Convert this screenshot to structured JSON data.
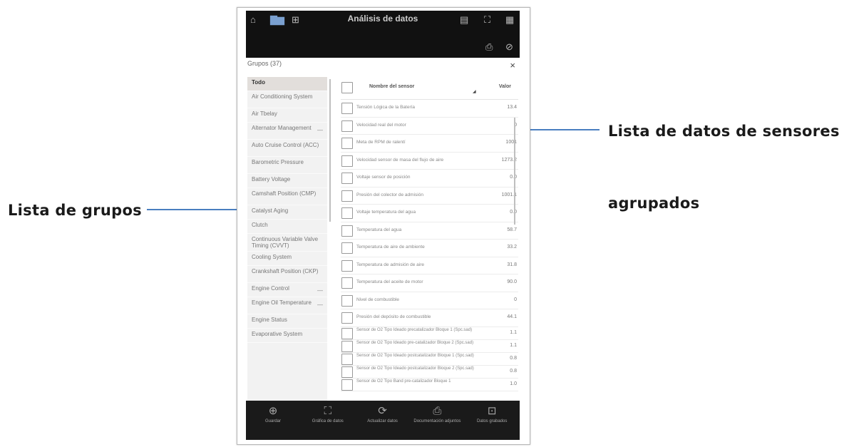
{
  "callouts": {
    "left_label": "Lista de grupos",
    "right_label_line1": "Lista de datos de sensores",
    "right_label_line2": "agrupados"
  },
  "app": {
    "title": "Análisis de datos",
    "groups_header": "Grupos (37)",
    "close_icon": "×"
  },
  "groups": [
    {
      "label": "Todo",
      "selected": true
    },
    {
      "label": "Air Conditioning System"
    },
    {
      "label": "Air Tbelay"
    },
    {
      "label": "Alternator Management",
      "dash": "—"
    },
    {
      "label": "Auto Cruise Control (ACC)"
    },
    {
      "label": "Barometric Pressure"
    },
    {
      "label": "Battery Voltage"
    },
    {
      "label": "Camshaft Position (CMP)"
    },
    {
      "label": "Catalyst Aging"
    },
    {
      "label": "Clutch"
    },
    {
      "label": "Continuous Variable Valve Timing (CVVT)"
    },
    {
      "label": "Cooling System"
    },
    {
      "label": "Crankshaft Position (CKP)"
    },
    {
      "label": "Engine Control",
      "dash": "—"
    },
    {
      "label": "Engine Oil Temperature",
      "dash": "—"
    },
    {
      "label": "Engine Status"
    },
    {
      "label": "Evaporative System"
    }
  ],
  "table": {
    "col_name": "Nombre del sensor",
    "col_value": "Valor",
    "rows": [
      {
        "name": "Tensión Lógica de la Batería",
        "value": "13.4"
      },
      {
        "name": "Velocidad real del motor",
        "value": "0"
      },
      {
        "name": "Meta de RPM de ralentí",
        "value": "1001"
      },
      {
        "name": "Velocidad sensor de masa del flujo de aire",
        "value": "1273.2"
      },
      {
        "name": "Voltaje sensor de posición",
        "value": "0.0"
      },
      {
        "name": "Presión del colector de admisión",
        "value": "1001.1"
      },
      {
        "name": "Voltaje temperatura del agua",
        "value": "0.0"
      },
      {
        "name": "Temperatura del agua",
        "value": "58.7"
      },
      {
        "name": "Temperatura de aire de ambiente",
        "value": "33.2"
      },
      {
        "name": "Temperatura de admisión de aire",
        "value": "31.8"
      },
      {
        "name": "Temperatura del aceite de motor",
        "value": "90.0"
      },
      {
        "name": "Nivel de combustible",
        "value": "0"
      },
      {
        "name": "Presión del depósito de combustible",
        "value": "44.1"
      }
    ],
    "multi_rows": [
      {
        "name": "Sensor de O2 Tipo Ideado precatalizador Bloque 1 (Spc.sad)",
        "value": "1.1"
      },
      {
        "name": "Sensor de O2 Tipo Ideado pre-catalizador Bloque 2 (Spc.sad)",
        "value": "1.1"
      },
      {
        "name": "Sensor de O2 Tipo Ideado postcatalizador Bloque 1 (Spc.sad)",
        "value": "0.8"
      },
      {
        "name": "Sensor de O2 Tipo Ideado postcatalizador Bloque 2 (Spc.sad)",
        "value": "0.8"
      },
      {
        "name": "Sensor de O2 Tipo Band pre-catalizador Bloque 1",
        "value": "1.0"
      }
    ]
  },
  "bottom_bar": [
    {
      "icon": "⊕",
      "label": "Guardar"
    },
    {
      "icon": "⛶",
      "label": "Gráfica de datos"
    },
    {
      "icon": "⟳",
      "label": "Actualizar datos"
    },
    {
      "icon": "⎙",
      "label": "Documentación adjuntos"
    },
    {
      "icon": "⊡",
      "label": "Datos grabados"
    }
  ],
  "colors": {
    "accent": "#3d74c0",
    "bar": "#111111"
  }
}
